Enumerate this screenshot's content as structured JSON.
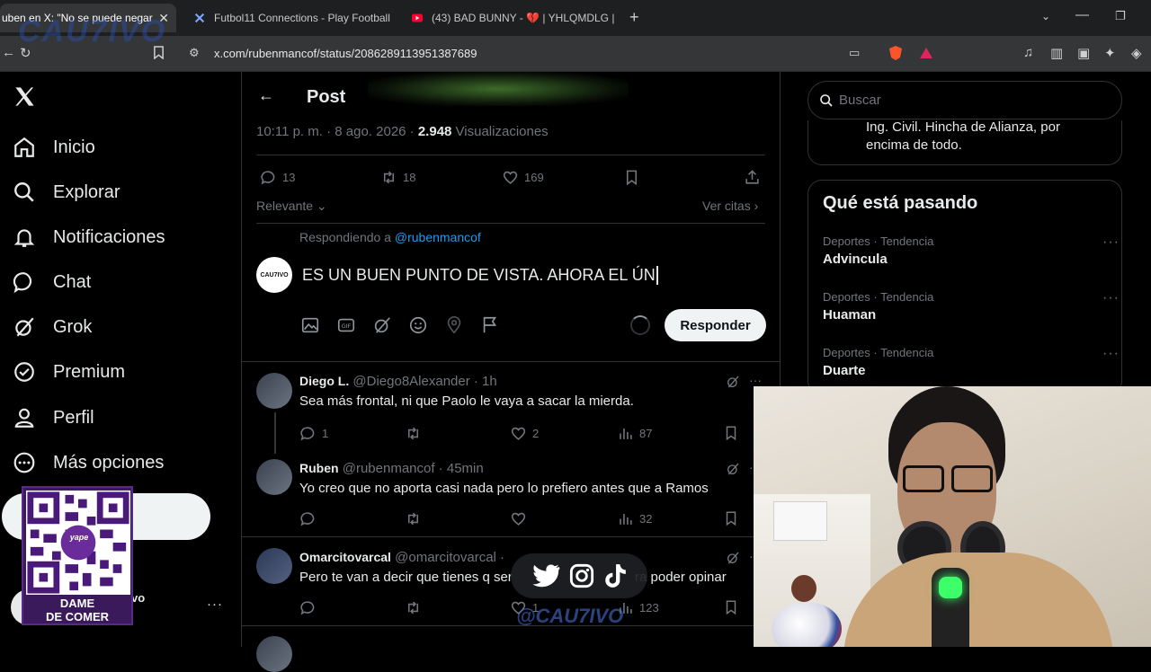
{
  "browser": {
    "tabs": [
      {
        "title": "uben en X: \"No se puede negar"
      },
      {
        "title": "Futbol11 Connections - Play Football"
      },
      {
        "title": "(43) BAD BUNNY - 💔 | YHLQMDLG |"
      }
    ],
    "url": "x.com/rubenmancof/status/2086289113951387689"
  },
  "nav": {
    "items": [
      {
        "label": "Inicio"
      },
      {
        "label": "Explorar"
      },
      {
        "label": "Notificaciones"
      },
      {
        "label": "Chat"
      },
      {
        "label": "Grok"
      },
      {
        "label": "Premium"
      },
      {
        "label": "Perfil"
      },
      {
        "label": "Más opciones"
      }
    ],
    "account_tail": "vo"
  },
  "post": {
    "header": "Post",
    "meta_time": "10:11 p. m. · 8 ago. 2026 · ",
    "views_count": "2.948",
    "views_label": " Visualizaciones",
    "replies": "13",
    "reposts": "18",
    "likes": "169",
    "sort_label": "Relevante",
    "quotes_label": "Ver citas"
  },
  "composer": {
    "replying_prefix": "Respondiendo a ",
    "replying_handle": "@rubenmancof",
    "draft_text": "ES UN BUEN PUNTO DE VISTA. AHORA EL ÚN",
    "submit_label": "Responder",
    "avatar_text": "CAU7IVO"
  },
  "replies": [
    {
      "name": "Diego L.",
      "handle": "@Diego8Alexander · 1h",
      "text": "Sea más frontal, ni que Paolo le vaya a sacar la mierda.",
      "replies": "1",
      "reposts": "",
      "likes": "2",
      "views": "87"
    },
    {
      "name": "Ruben",
      "handle": "@rubenmancof · 45min",
      "text": "Yo creo que no aporta casi nada pero lo prefiero antes que a Ramos",
      "replies": "",
      "reposts": "",
      "likes": "",
      "views": "32"
    },
    {
      "name": "Omarcitovarcal",
      "handle": "@omarcitovarcal · ",
      "text": "Pero te van a decir que tienes q ser",
      "text_tail": "ra poder opinar",
      "replies": "",
      "reposts": "",
      "likes": "1",
      "views": "123"
    }
  ],
  "sidebar": {
    "search_placeholder": "Buscar",
    "bio_line1": "Ing. Civil. Hincha de Alianza, por",
    "bio_line2": "encima de todo.",
    "trends_title": "Qué está pasando",
    "trends": [
      {
        "category": "Deportes · Tendencia",
        "name": "Advincula"
      },
      {
        "category": "Deportes · Tendencia",
        "name": "Huaman"
      },
      {
        "category": "Deportes · Tendencia",
        "name": "Duarte"
      }
    ]
  },
  "overlay": {
    "watermark": "CAU7IVO",
    "social_handle": "@CAU7IVO",
    "qr_brand": "yape",
    "qr_line1": "DAME",
    "qr_line2": "DE COMER"
  },
  "colors": {
    "accent": "#1d9bf0",
    "background": "#000000",
    "border": "#2f3336",
    "muted": "#71767b"
  }
}
